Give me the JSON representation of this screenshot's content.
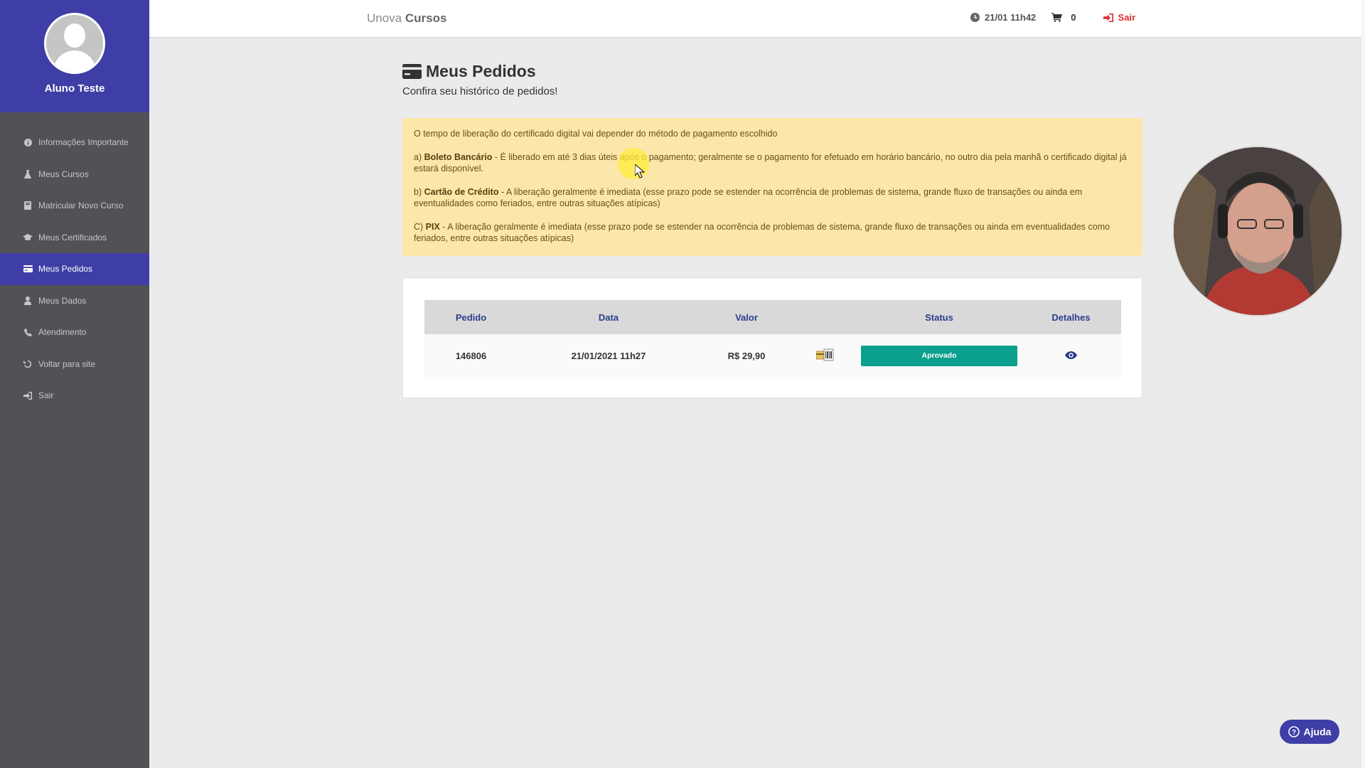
{
  "colors": {
    "brand": "#3f3ea6",
    "sidebar": "#525256",
    "notice_bg": "#fbe7a9",
    "status_approved": "#0b9f8e",
    "logout": "#d9302f"
  },
  "sidebar": {
    "user_name": "Aluno Teste",
    "items": [
      {
        "label": "Informações Importante",
        "icon": "info-icon"
      },
      {
        "label": "Meus Cursos",
        "icon": "flask-icon"
      },
      {
        "label": "Matricular Novo Curso",
        "icon": "book-icon"
      },
      {
        "label": "Meus Certificados",
        "icon": "graduation-cap-icon"
      },
      {
        "label": "Meus Pedidos",
        "icon": "credit-card-icon",
        "active": true
      },
      {
        "label": "Meus Dados",
        "icon": "user-icon"
      },
      {
        "label": "Atendimento",
        "icon": "phone-icon"
      },
      {
        "label": "Voltar para site",
        "icon": "undo-icon"
      },
      {
        "label": "Sair",
        "icon": "sign-in-icon"
      }
    ]
  },
  "topbar": {
    "brand_light": "Unova",
    "brand_bold": "Cursos",
    "datetime": "21/01 11h42",
    "cart_count": "0",
    "logout_label": "Sair"
  },
  "page": {
    "title": "Meus Pedidos",
    "subtitle": "Confira seu histórico de pedidos!"
  },
  "notice": {
    "intro": "O tempo de liberação do certificado digital vai depender do método de pagamento escolhido",
    "items": [
      {
        "prefix": "a) ",
        "bold": "Boleto Bancário",
        "text": " - É liberado em até 3 dias úteis após o pagamento; geralmente se o pagamento for efetuado em horário bancário, no outro dia pela manhã o certificado digital já estará disponível."
      },
      {
        "prefix": "b) ",
        "bold": "Cartão de Crédito",
        "text": " - A liberação geralmente é imediata (esse prazo pode se estender na ocorrência de problemas de sistema, grande fluxo de transações ou ainda em eventualidades como feriados, entre outras situações atípicas)"
      },
      {
        "prefix": "C) ",
        "bold": "PIX",
        "text": " - A liberação geralmente é imediata (esse prazo pode se estender na ocorrência de problemas de sistema, grande fluxo de transações ou ainda em eventualidades como feriados, entre outras situações atípicas)"
      }
    ]
  },
  "orders": {
    "columns": [
      "Pedido",
      "Data",
      "Valor",
      "",
      "Status",
      "Detalhes"
    ],
    "rows": [
      {
        "pedido": "146806",
        "data": "21/01/2021 11h27",
        "valor": "R$ 29,90",
        "payment_icon": "boleto-icon",
        "status": "Aprovado",
        "details_icon": "eye-icon"
      }
    ]
  },
  "help": {
    "label": "Ajuda"
  }
}
